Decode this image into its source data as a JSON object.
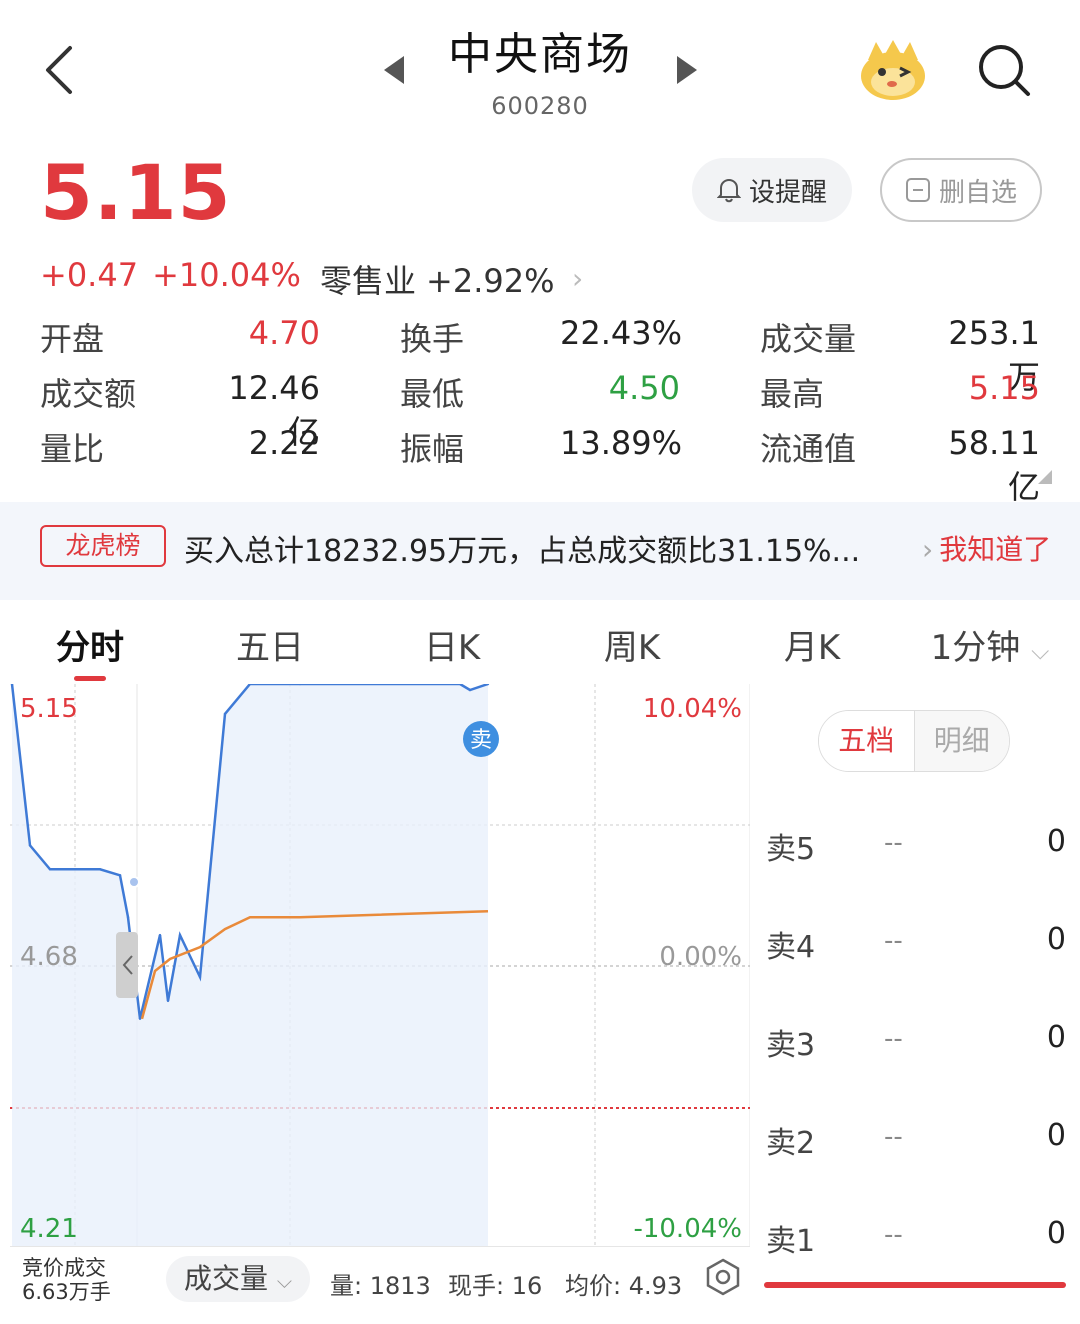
{
  "header": {
    "title": "中央商场",
    "code": "600280"
  },
  "quote": {
    "price": "5.15",
    "change": "+0.47",
    "change_pct": "+10.04%",
    "industry_name": "零售业",
    "industry_pct": "+2.92%",
    "remind_label": "设提醒",
    "delete_label": "删自选"
  },
  "stats": [
    {
      "label": "开盘",
      "value": "4.70",
      "color": "red"
    },
    {
      "label": "换手",
      "value": "22.43%",
      "color": "normal"
    },
    {
      "label": "成交量",
      "value": "253.1万",
      "color": "normal"
    },
    {
      "label": "成交额",
      "value": "12.46亿",
      "color": "normal"
    },
    {
      "label": "最低",
      "value": "4.50",
      "color": "green"
    },
    {
      "label": "最高",
      "value": "5.15",
      "color": "red"
    },
    {
      "label": "量比",
      "value": "2.22",
      "color": "normal"
    },
    {
      "label": "振幅",
      "value": "13.89%",
      "color": "normal"
    },
    {
      "label": "流通值",
      "value": "58.11亿",
      "color": "normal"
    }
  ],
  "banner": {
    "tag": "龙虎榜",
    "text": "买入总计18232.95万元，占总成交额比31.15%...",
    "action": "我知道了"
  },
  "tabs": [
    "分时",
    "五日",
    "日K",
    "周K",
    "月K",
    "1分钟"
  ],
  "chart": {
    "y_labels_left": [
      "5.15",
      "4.68",
      "4.21"
    ],
    "y_labels_right": [
      "10.04%",
      "0.00%",
      "-10.04%"
    ],
    "sell_marker": "卖"
  },
  "chart_data": {
    "type": "line",
    "ylim": [
      4.21,
      5.15
    ],
    "series": [
      {
        "values": [
          5.15,
          4.88,
          4.84,
          4.84,
          4.83,
          4.76,
          4.59,
          4.73,
          4.62,
          4.73,
          4.66,
          5.1,
          5.15,
          5.15,
          5.15,
          5.14,
          5.15
        ]
      },
      {
        "values": [
          4.59,
          4.67,
          4.69,
          4.71,
          4.74,
          4.76,
          4.76,
          4.77
        ]
      }
    ]
  },
  "orderbook": {
    "tab_active": "五档",
    "tab_inactive": "明细",
    "rows": [
      {
        "label": "卖5",
        "price": "--",
        "vol": "0"
      },
      {
        "label": "卖4",
        "price": "--",
        "vol": "0"
      },
      {
        "label": "卖3",
        "price": "--",
        "vol": "0"
      },
      {
        "label": "卖2",
        "price": "--",
        "vol": "0"
      },
      {
        "label": "卖1",
        "price": "--",
        "vol": "0"
      }
    ]
  },
  "bottom": {
    "auction_line1": "竞价成交",
    "auction_line2": "6.63万手",
    "volume_selector": "成交量",
    "vol": "量: 1813",
    "now": "现手: 16",
    "avg": "均价: 4.93"
  },
  "colors": {
    "up": "#e0393e",
    "down": "#2ea043",
    "price_line": "#3f7ad6",
    "avg_line": "#e98a3a"
  }
}
